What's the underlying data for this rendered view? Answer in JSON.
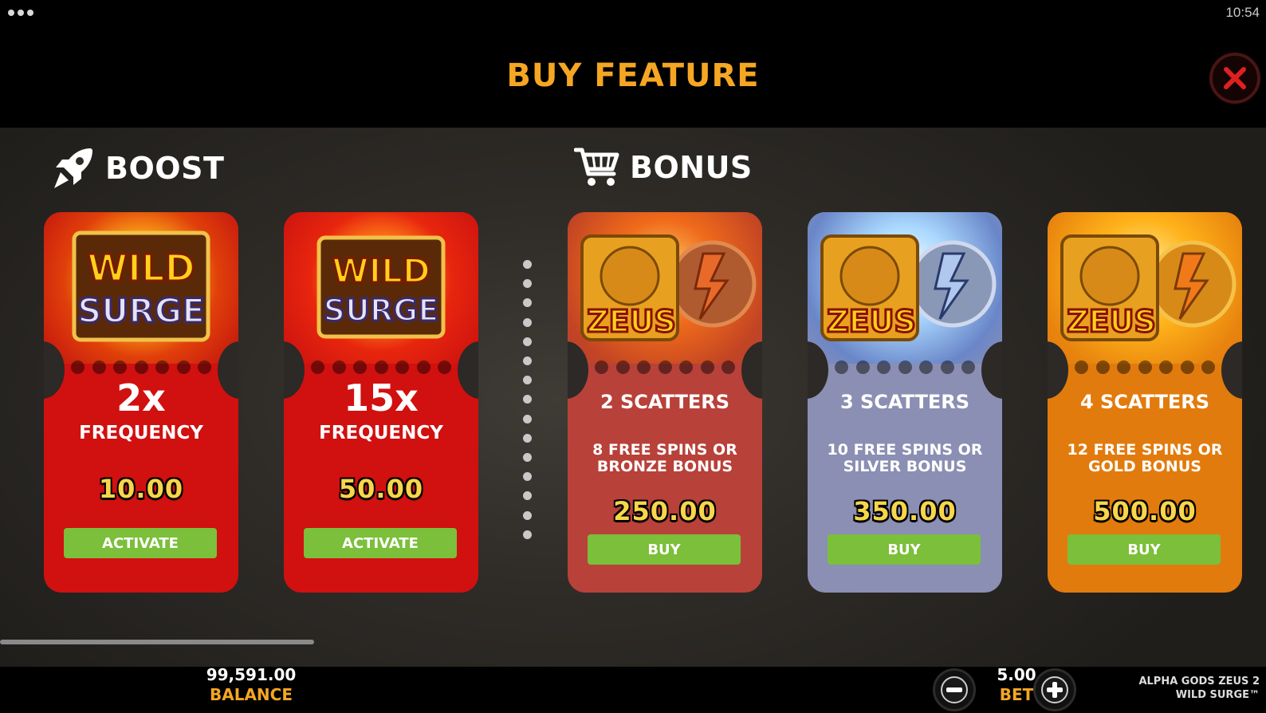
{
  "status": {
    "time": "10:54"
  },
  "header": {
    "title": "BUY FEATURE"
  },
  "boost": {
    "label": "BOOST",
    "cards": [
      {
        "multiplier": "2x",
        "subtitle": "FREQUENCY",
        "price": "10.00",
        "button": "ACTIVATE",
        "art_text_1": "WILD",
        "art_text_2": "SURGE"
      },
      {
        "multiplier": "15x",
        "subtitle": "FREQUENCY",
        "price": "50.00",
        "button": "ACTIVATE",
        "art_text_1": "WILD",
        "art_text_2": "SURGE"
      }
    ]
  },
  "bonus": {
    "label": "BONUS",
    "cards": [
      {
        "title": "2 SCATTERS",
        "description": "8 FREE SPINS OR BRONZE BONUS",
        "price": "250.00",
        "button": "BUY",
        "art_text": "ZEUS"
      },
      {
        "title": "3 SCATTERS",
        "description": "10 FREE SPINS OR SILVER BONUS",
        "price": "350.00",
        "button": "BUY",
        "art_text": "ZEUS"
      },
      {
        "title": "4 SCATTERS",
        "description": "12 FREE SPINS OR GOLD BONUS",
        "price": "500.00",
        "button": "BUY",
        "art_text": "ZEUS"
      }
    ]
  },
  "footer": {
    "balance_value": "99,591.00",
    "balance_label": "BALANCE",
    "bet_value": "5.00",
    "bet_label": "BET",
    "game_name_1": "ALPHA GODS ZEUS 2",
    "game_name_2": "WILD SURGE™"
  },
  "colors": {
    "accent": "#f5a623",
    "price": "#f7d64a",
    "button": "#7bbf3a",
    "red": "#d11010",
    "bronze": "#b8413a",
    "silver": "#8b8fb3",
    "gold": "#e27b0d"
  },
  "icons": [
    "menu-icon",
    "close-icon",
    "rocket-icon",
    "cart-icon",
    "minus-icon",
    "plus-icon"
  ]
}
